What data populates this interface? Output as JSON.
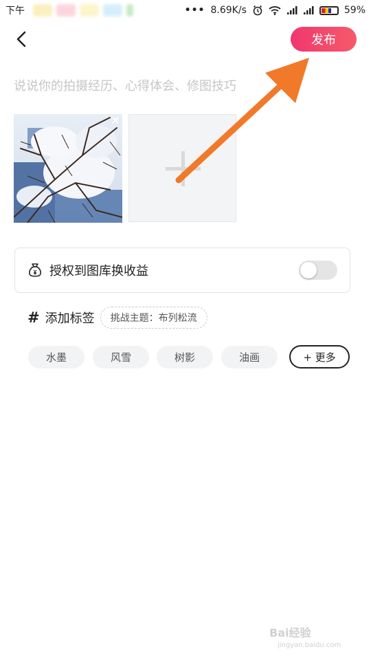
{
  "status_bar": {
    "time": "下午",
    "speed": "8.69K/s",
    "dots": "•••",
    "battery": "59%"
  },
  "header": {
    "back_icon": "chevron-left-icon",
    "publish_label": "发布"
  },
  "caption": {
    "placeholder": "说说你的拍摄经历、心得体会、修图技巧",
    "value": ""
  },
  "photos": {
    "add_icon": "plus-icon"
  },
  "authorize": {
    "icon": "money-bag-icon",
    "label": "授权到图库换收益",
    "enabled": false
  },
  "tags": {
    "title": "添加标签",
    "challenge": "挑战主题：布列松流",
    "chips": [
      "水墨",
      "风雪",
      "树影",
      "油画"
    ],
    "more_label": "+ 更多"
  },
  "watermark": {
    "brand": "Bai经验",
    "url": "jingyan.baidu.com"
  },
  "colors": {
    "publish_start": "#f0376e",
    "publish_end": "#f65a6a",
    "arrow": "#f07a2a"
  }
}
